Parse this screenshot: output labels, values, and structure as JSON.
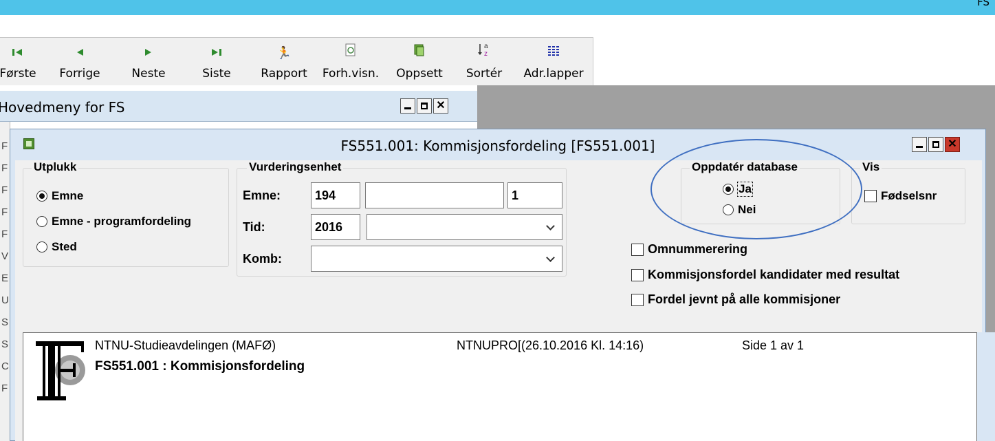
{
  "app": {
    "title_fragment": "FS"
  },
  "toolbar": {
    "items": [
      {
        "label": "Første",
        "icon": "first-record-icon"
      },
      {
        "label": "Forrige",
        "icon": "previous-record-icon"
      },
      {
        "label": "Neste",
        "icon": "next-record-icon"
      },
      {
        "label": "Siste",
        "icon": "last-record-icon"
      },
      {
        "label": "Rapport",
        "icon": "run-report-icon"
      },
      {
        "label": "Forh.visn.",
        "icon": "print-preview-icon"
      },
      {
        "label": "Oppsett",
        "icon": "page-setup-icon"
      },
      {
        "label": "Sortér",
        "icon": "sort-az-icon"
      },
      {
        "label": "Adr.lapper",
        "icon": "address-labels-icon"
      }
    ]
  },
  "hovedmeny": {
    "title": "Hovedmeny for FS",
    "side_letters": [
      "F",
      "F",
      "F",
      "F",
      "F",
      "V",
      "E",
      "U",
      "S",
      "S",
      "C",
      "F"
    ]
  },
  "dialog": {
    "title": "FS551.001: Kommisjonsfordeling  [FS551.001]",
    "utplukk": {
      "title": "Utplukk",
      "options": [
        "Emne",
        "Emne - programfordeling",
        "Sted"
      ],
      "selected": "Emne"
    },
    "vurderingsenhet": {
      "title": "Vurderingsenhet",
      "emne_label": "Emne:",
      "emne_code": "194",
      "emne_name": "",
      "emne_version": "1",
      "tid_label": "Tid:",
      "tid_year": "2016",
      "tid_term": "",
      "komb_label": "Komb:",
      "komb_value": ""
    },
    "oppdater": {
      "title": "Oppdatér database",
      "options": [
        "Ja",
        "Nei"
      ],
      "selected": "Ja"
    },
    "vis": {
      "title": "Vis",
      "fodselsnr_label": "Fødselsnr",
      "fodselsnr_checked": false
    },
    "checkboxes": [
      {
        "label": "Omnummerering",
        "checked": false
      },
      {
        "label": "Kommisjonsfordel kandidater med resultat",
        "checked": false
      },
      {
        "label": "Fordel jevnt på alle kommisjoner",
        "checked": false
      }
    ],
    "report": {
      "institution": "NTNU-Studieavdelingen  (MAFØ)",
      "system": "NTNUPRO[(26.10.2016 Kl. 14:16)",
      "page": "Side 1 av 1",
      "heading": "FS551.001 : Kommisjonsfordeling"
    }
  },
  "colors": {
    "titlebar": "#4fc3e9",
    "annotation": "#3f6fc1",
    "close_button": "#c8382a"
  }
}
